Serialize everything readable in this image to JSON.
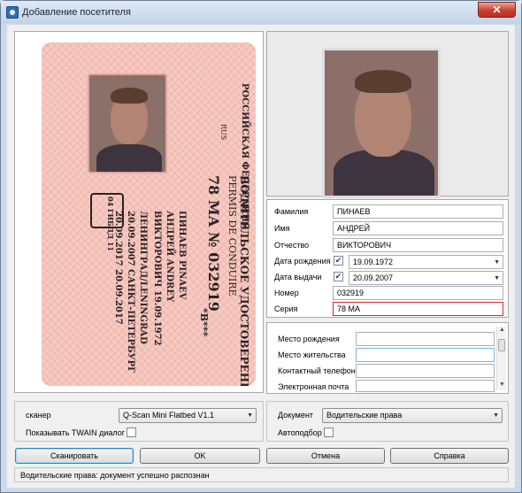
{
  "window": {
    "title": "Добавление посетителя",
    "close_glyph": "✕"
  },
  "card": {
    "header": "ВОДИТЕЛЬСКОЕ УДОСТОВЕРЕНИЕ",
    "header_fr": "PERMIS DE CONDUIRE",
    "country": "РОССИЙСКАЯ ФЕДЕРАЦИЯ",
    "country_code": "RUS",
    "number": "78 МА № 032919",
    "categories": "*В***",
    "surname": "ПИНАЕВ PINAEV",
    "name": "АНДРЕЙ ANDREY",
    "patronymic": "ВИКТОРОВИЧ 19.09.1972",
    "birthplace": "ЛЕНИНГРАД/LENINGRAD",
    "issued": "20.09.2007 САНКТ-ПЕТЕРБУРГ",
    "valid": "20.09.2017 20.09.2017",
    "stamp": "04 ГИБДД 11"
  },
  "fields": {
    "surname_label": "Фамилия",
    "surname_value": "ПИНАЕВ",
    "name_label": "Имя",
    "name_value": "АНДРЕЙ",
    "patronymic_label": "Отчество",
    "patronymic_value": "ВИКТОРОВИЧ",
    "birth_date_label": "Дата рождения",
    "birth_date_value": "19.09.1972",
    "issue_date_label": "Дата выдачи",
    "issue_date_value": "20.09.2007",
    "number_label": "Номер",
    "number_value": "032919",
    "series_label": "Серия",
    "series_value": "78 МА"
  },
  "extra": {
    "birthplace_label": "Место рождения",
    "residence_label": "Место жительства",
    "phone_label": "Контактный телефон",
    "email_label": "Электронная почта"
  },
  "scanner": {
    "label": "сканер",
    "selected": "Q-Scan Mini Flatbed V1.1",
    "twain_label": "Показывать TWAIN диалог"
  },
  "document": {
    "label": "Документ",
    "selected": "Водительские права",
    "autoselect_label": "Автоподбор"
  },
  "buttons": {
    "scan": "Сканировать",
    "ok": "OK",
    "cancel": "Отмена",
    "help": "Справка"
  },
  "status": {
    "text": "Водительские права: документ успешно распознан"
  },
  "colors": {
    "error_border": "#e0242b",
    "card_pink": "#f6c9c1",
    "title_bar": "#c3d3e8"
  }
}
